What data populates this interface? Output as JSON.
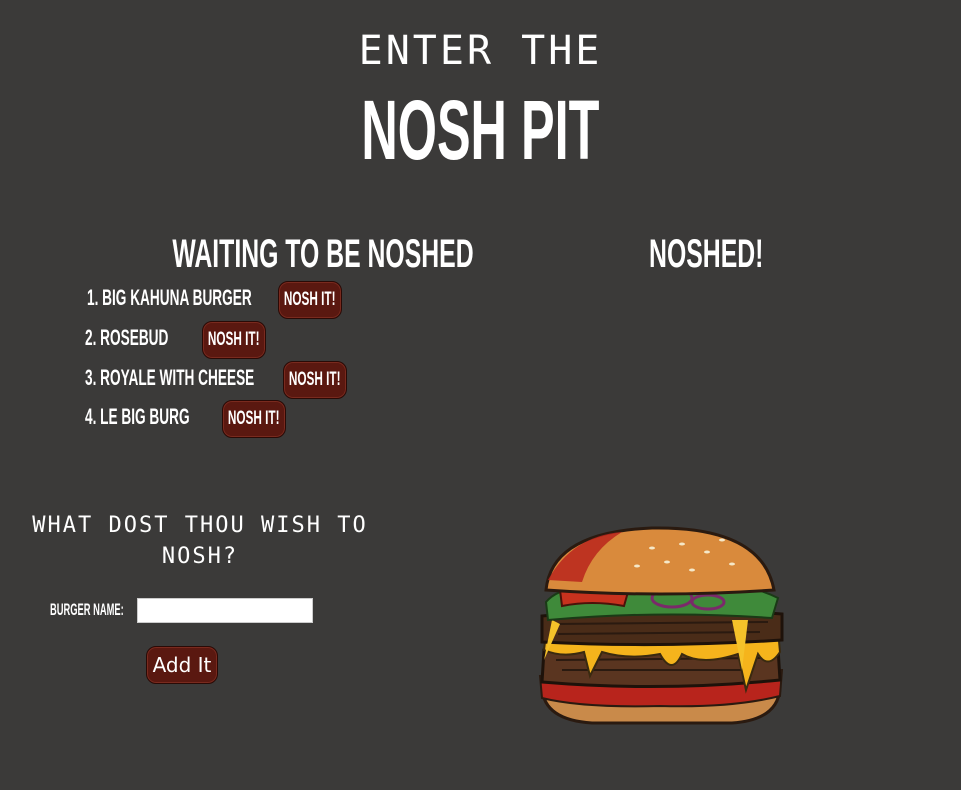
{
  "header": {
    "pre_title": "ENTER THE",
    "title": "NOSH PIT"
  },
  "waiting": {
    "heading": "WAITING TO BE NOSHED",
    "items": [
      {
        "label": "1. BIG KAHUNA BURGER",
        "button": "NOSH IT!"
      },
      {
        "label": "2. ROSEBUD",
        "button": "NOSH IT!"
      },
      {
        "label": "3. ROYALE WITH CHEESE",
        "button": "NOSH IT!"
      },
      {
        "label": "4. LE BIG BURG",
        "button": "NOSH IT!"
      }
    ]
  },
  "noshed": {
    "heading": "NOSHED!"
  },
  "form": {
    "title": "WHAT DOST THOU WISH TO NOSH?",
    "label": "BURGER NAME:",
    "input_value": "",
    "submit_label": "Add It"
  },
  "colors": {
    "background": "#3b3a39",
    "button": "#5a1810",
    "text": "#ffffff"
  },
  "image": {
    "icon": "burger-illustration"
  }
}
